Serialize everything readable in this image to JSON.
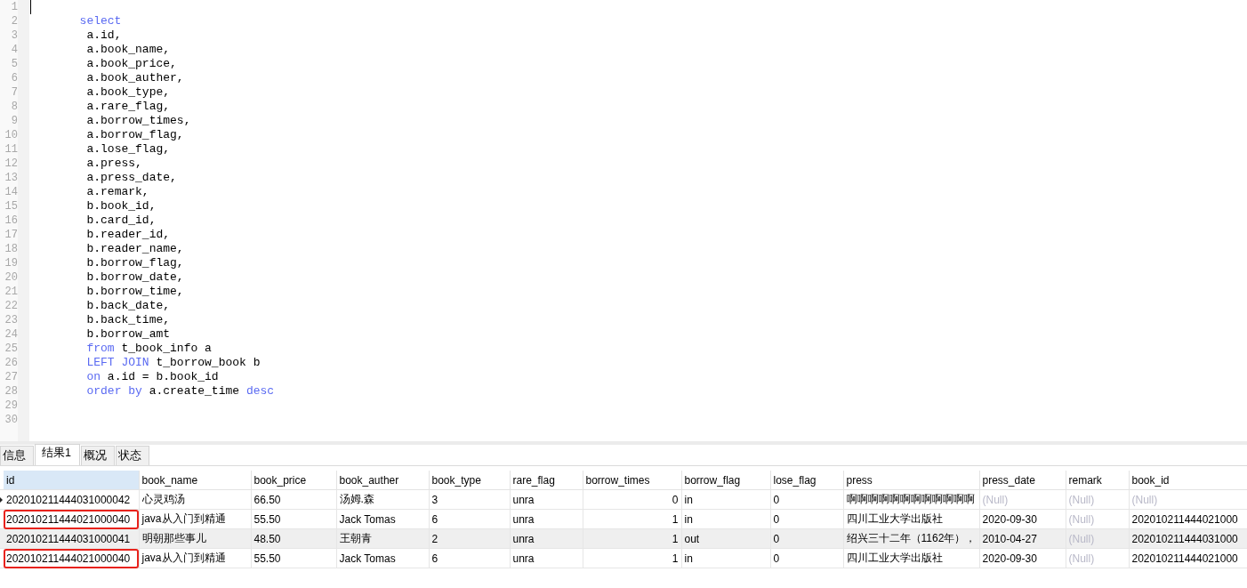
{
  "editor": {
    "lines": [
      {
        "number": "1",
        "cursor": true
      },
      {
        "number": "2",
        "cursor": false,
        "segments": [
          {
            "text": "       select",
            "kind": "keyword"
          }
        ]
      },
      {
        "number": "3",
        "cursor": false,
        "segments": [
          {
            "text": "        a.id,",
            "kind": "plain"
          }
        ]
      },
      {
        "number": "4",
        "cursor": false,
        "segments": [
          {
            "text": "        a.book_name,",
            "kind": "plain"
          }
        ]
      },
      {
        "number": "5",
        "cursor": false,
        "segments": [
          {
            "text": "        a.book_price,",
            "kind": "plain"
          }
        ]
      },
      {
        "number": "6",
        "cursor": false,
        "segments": [
          {
            "text": "        a.book_auther,",
            "kind": "plain"
          }
        ]
      },
      {
        "number": "7",
        "cursor": false,
        "segments": [
          {
            "text": "        a.book_type,",
            "kind": "plain"
          }
        ]
      },
      {
        "number": "8",
        "cursor": false,
        "segments": [
          {
            "text": "        a.rare_flag,",
            "kind": "plain"
          }
        ]
      },
      {
        "number": "9",
        "cursor": false,
        "segments": [
          {
            "text": "        a.borrow_times,",
            "kind": "plain"
          }
        ]
      },
      {
        "number": "10",
        "cursor": false,
        "segments": [
          {
            "text": "        a.borrow_flag,",
            "kind": "plain"
          }
        ]
      },
      {
        "number": "11",
        "cursor": false,
        "segments": [
          {
            "text": "        a.lose_flag,",
            "kind": "plain"
          }
        ]
      },
      {
        "number": "12",
        "cursor": false,
        "segments": [
          {
            "text": "        a.press,",
            "kind": "plain"
          }
        ]
      },
      {
        "number": "13",
        "cursor": false,
        "segments": [
          {
            "text": "        a.press_date,",
            "kind": "plain"
          }
        ]
      },
      {
        "number": "14",
        "cursor": false,
        "segments": [
          {
            "text": "        a.remark,",
            "kind": "plain"
          }
        ]
      },
      {
        "number": "15",
        "cursor": false,
        "segments": [
          {
            "text": "        b.book_id,",
            "kind": "plain"
          }
        ]
      },
      {
        "number": "16",
        "cursor": false,
        "segments": [
          {
            "text": "        b.card_id,",
            "kind": "plain"
          }
        ]
      },
      {
        "number": "17",
        "cursor": false,
        "segments": [
          {
            "text": "        b.reader_id,",
            "kind": "plain"
          }
        ]
      },
      {
        "number": "18",
        "cursor": false,
        "segments": [
          {
            "text": "        b.reader_name,",
            "kind": "plain"
          }
        ]
      },
      {
        "number": "19",
        "cursor": false,
        "segments": [
          {
            "text": "        b.borrow_flag,",
            "kind": "plain"
          }
        ]
      },
      {
        "number": "20",
        "cursor": false,
        "segments": [
          {
            "text": "        b.borrow_date,",
            "kind": "plain"
          }
        ]
      },
      {
        "number": "21",
        "cursor": false,
        "segments": [
          {
            "text": "        b.borrow_time,",
            "kind": "plain"
          }
        ]
      },
      {
        "number": "22",
        "cursor": false,
        "segments": [
          {
            "text": "        b.back_date,",
            "kind": "plain"
          }
        ]
      },
      {
        "number": "23",
        "cursor": false,
        "segments": [
          {
            "text": "        b.back_time,",
            "kind": "plain"
          }
        ]
      },
      {
        "number": "24",
        "cursor": false,
        "segments": [
          {
            "text": "        b.borrow_amt",
            "kind": "plain"
          }
        ]
      },
      {
        "number": "25",
        "cursor": false,
        "segments": [
          {
            "text": "        from",
            "kind": "keyword"
          },
          {
            "text": " t_book_info a",
            "kind": "plain"
          }
        ]
      },
      {
        "number": "26",
        "cursor": false,
        "segments": [
          {
            "text": "        LEFT JOIN",
            "kind": "keyword"
          },
          {
            "text": " t_borrow_book b",
            "kind": "plain"
          }
        ]
      },
      {
        "number": "27",
        "cursor": false,
        "segments": [
          {
            "text": "        on",
            "kind": "keyword"
          },
          {
            "text": " a.id = b.book_id",
            "kind": "plain"
          }
        ]
      },
      {
        "number": "28",
        "cursor": false,
        "segments": [
          {
            "text": "        order by",
            "kind": "keyword"
          },
          {
            "text": " a.create_time ",
            "kind": "plain"
          },
          {
            "text": "desc",
            "kind": "keyword"
          }
        ]
      },
      {
        "number": "29",
        "cursor": false
      },
      {
        "number": "30",
        "cursor": false
      }
    ]
  },
  "tabs": [
    {
      "label": "信息",
      "selected": false
    },
    {
      "label": "结果1",
      "selected": true
    },
    {
      "label": "概况",
      "selected": false
    },
    {
      "label": "状态",
      "selected": false
    }
  ],
  "table": {
    "columns": [
      {
        "label": "id",
        "selected": true,
        "kind": "text"
      },
      {
        "label": "book_name",
        "selected": false,
        "kind": "text"
      },
      {
        "label": "book_price",
        "selected": false,
        "kind": "text"
      },
      {
        "label": "book_auther",
        "selected": false,
        "kind": "text"
      },
      {
        "label": "book_type",
        "selected": false,
        "kind": "text"
      },
      {
        "label": "rare_flag",
        "selected": false,
        "kind": "text"
      },
      {
        "label": "borrow_times",
        "selected": false,
        "kind": "number"
      },
      {
        "label": "borrow_flag",
        "selected": false,
        "kind": "text"
      },
      {
        "label": "lose_flag",
        "selected": false,
        "kind": "text"
      },
      {
        "label": "press",
        "selected": false,
        "kind": "text"
      },
      {
        "label": "press_date",
        "selected": false,
        "kind": "text"
      },
      {
        "label": "remark",
        "selected": false,
        "kind": "text"
      },
      {
        "label": "book_id",
        "selected": false,
        "kind": "text"
      }
    ],
    "rows": [
      {
        "current": true,
        "shaded": false,
        "outlined": false,
        "cells": [
          {
            "text": "202010211444031000042",
            "kind": "value"
          },
          {
            "text": "心灵鸡汤",
            "kind": "value"
          },
          {
            "text": "66.50",
            "kind": "value"
          },
          {
            "text": "汤姆.森",
            "kind": "value"
          },
          {
            "text": "3",
            "kind": "value"
          },
          {
            "text": "unra",
            "kind": "value"
          },
          {
            "text": "0",
            "kind": "value"
          },
          {
            "text": "in",
            "kind": "value"
          },
          {
            "text": "0",
            "kind": "value"
          },
          {
            "text": "啊啊啊啊啊啊啊啊啊啊啊啊",
            "kind": "value"
          },
          {
            "text": "(Null)",
            "kind": "null"
          },
          {
            "text": "(Null)",
            "kind": "null"
          },
          {
            "text": "(Null)",
            "kind": "null"
          }
        ]
      },
      {
        "current": false,
        "shaded": false,
        "outlined": true,
        "cells": [
          {
            "text": "202010211444021000040",
            "kind": "value"
          },
          {
            "text": "java从入门到精通",
            "kind": "value"
          },
          {
            "text": "55.50",
            "kind": "value"
          },
          {
            "text": "Jack Tomas",
            "kind": "value"
          },
          {
            "text": "6",
            "kind": "value"
          },
          {
            "text": "unra",
            "kind": "value"
          },
          {
            "text": "1",
            "kind": "value"
          },
          {
            "text": "in",
            "kind": "value"
          },
          {
            "text": "0",
            "kind": "value"
          },
          {
            "text": "四川工业大学出版社",
            "kind": "value"
          },
          {
            "text": "2020-09-30",
            "kind": "value"
          },
          {
            "text": "(Null)",
            "kind": "null"
          },
          {
            "text": "202010211444021000",
            "kind": "value"
          }
        ]
      },
      {
        "current": false,
        "shaded": true,
        "outlined": false,
        "cells": [
          {
            "text": "202010211444031000041",
            "kind": "value"
          },
          {
            "text": "明朝那些事儿",
            "kind": "value"
          },
          {
            "text": "48.50",
            "kind": "value"
          },
          {
            "text": "王朝青",
            "kind": "value"
          },
          {
            "text": "2",
            "kind": "value"
          },
          {
            "text": "unra",
            "kind": "value"
          },
          {
            "text": "1",
            "kind": "value"
          },
          {
            "text": "out",
            "kind": "value"
          },
          {
            "text": "0",
            "kind": "value"
          },
          {
            "text": "绍兴三十二年（1162年），",
            "kind": "value"
          },
          {
            "text": "2010-04-27",
            "kind": "value"
          },
          {
            "text": "(Null)",
            "kind": "null"
          },
          {
            "text": "202010211444031000",
            "kind": "value"
          }
        ]
      },
      {
        "current": false,
        "shaded": false,
        "outlined": true,
        "cells": [
          {
            "text": "202010211444021000040",
            "kind": "value"
          },
          {
            "text": "java从入门到精通",
            "kind": "value"
          },
          {
            "text": "55.50",
            "kind": "value"
          },
          {
            "text": "Jack Tomas",
            "kind": "value"
          },
          {
            "text": "6",
            "kind": "value"
          },
          {
            "text": "unra",
            "kind": "value"
          },
          {
            "text": "1",
            "kind": "value"
          },
          {
            "text": "in",
            "kind": "value"
          },
          {
            "text": "0",
            "kind": "value"
          },
          {
            "text": "四川工业大学出版社",
            "kind": "value"
          },
          {
            "text": "2020-09-30",
            "kind": "value"
          },
          {
            "text": "(Null)",
            "kind": "null"
          },
          {
            "text": "202010211444021000",
            "kind": "value"
          }
        ]
      }
    ]
  }
}
